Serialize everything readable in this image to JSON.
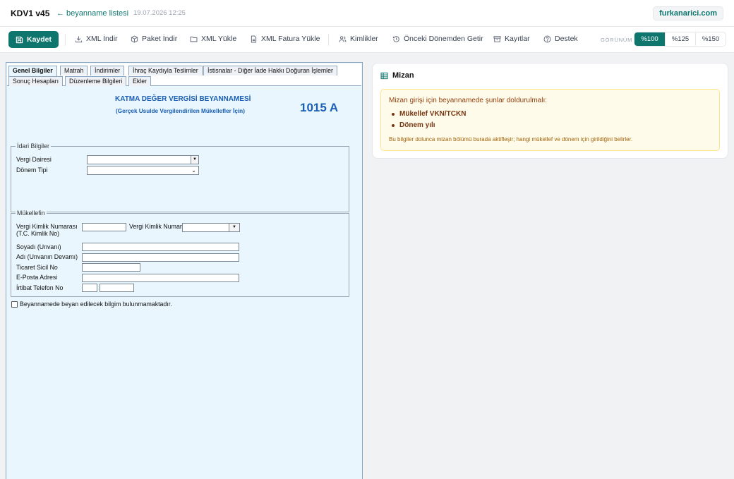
{
  "header": {
    "app_title": "KDV1 v45",
    "back_link": "← beyanname listesi",
    "timestamp": "19.07.2026 12:25",
    "domain": "furkanarici.com"
  },
  "toolbar": {
    "save_label": "Kaydet",
    "items": [
      {
        "label": "XML İndir",
        "icon": "download-icon"
      },
      {
        "label": "Paket İndir",
        "icon": "package-icon"
      },
      {
        "label": "XML Yükle",
        "icon": "folder-icon"
      },
      {
        "label": "XML Fatura Yükle",
        "icon": "document-icon"
      },
      {
        "label": "Kimlikler",
        "icon": "users-icon"
      },
      {
        "label": "Önceki Dönemden Getir",
        "icon": "history-icon"
      },
      {
        "label": "Kayıtlar",
        "icon": "archive-icon"
      },
      {
        "label": "Destek",
        "icon": "help-icon"
      }
    ],
    "view_label": "GÖRÜNÜM",
    "zoom_options": [
      "%100",
      "%125",
      "%150"
    ],
    "zoom_selected": "%100"
  },
  "form": {
    "tabs_row1": [
      "Genel Bilgiler",
      "Matrah",
      "İndirimler",
      "İhraç Kaydıyla Teslimler",
      "İstisnalar - Diğer İade Hakkı Doğuran İşlemler"
    ],
    "tabs_row2": [
      "Sonuç Hesapları",
      "Düzenleme Bilgileri",
      "Ekler"
    ],
    "active_tab": "Genel Bilgiler",
    "title": "KATMA DEĞER VERGİSİ BEYANNAMESİ",
    "subtitle": "(Gerçek Usulde Vergilendirilen Mükellefler İçin)",
    "code": "1015 A",
    "idari": {
      "legend": "İdari Bilgiler",
      "vergi_dairesi_label": "Vergi Dairesi",
      "donem_tipi_label": "Dönem Tipi"
    },
    "mukellef": {
      "legend": "Mükellefin",
      "vkn_label_1": "Vergi Kimlik Numarası",
      "vkn_label_2": "(T.C. Kimlik No)",
      "vkn_label_b": "Vergi Kimlik Numar",
      "soyadi_label": "Soyadı (Unvanı)",
      "adi_label": "Adı (Unvanın Devamı)",
      "ticaret_label": "Ticaret Sicil No",
      "eposta_label": "E-Posta Adresi",
      "telefon_label": "İrtibat Telefon No"
    },
    "checkbox_label": "Beyannamede beyan edilecek bilgim bulunmamaktadır."
  },
  "mizan": {
    "title": "Mizan",
    "intro": "Mizan girişi için beyannamede şunlar doldurulmalı:",
    "requirements": [
      "Mükellef VKN/TCKN",
      "Dönem yılı"
    ],
    "note": "Bu bilgiler dolunca mizan bölümü burada aktifleşir; hangi mükellef ve dönem için girildiğini belirler."
  },
  "colors": {
    "accent": "#0f766e",
    "form_bg": "#e9f6fd",
    "form_title": "#1a5fb4",
    "warn_bg": "#fffbeb"
  }
}
